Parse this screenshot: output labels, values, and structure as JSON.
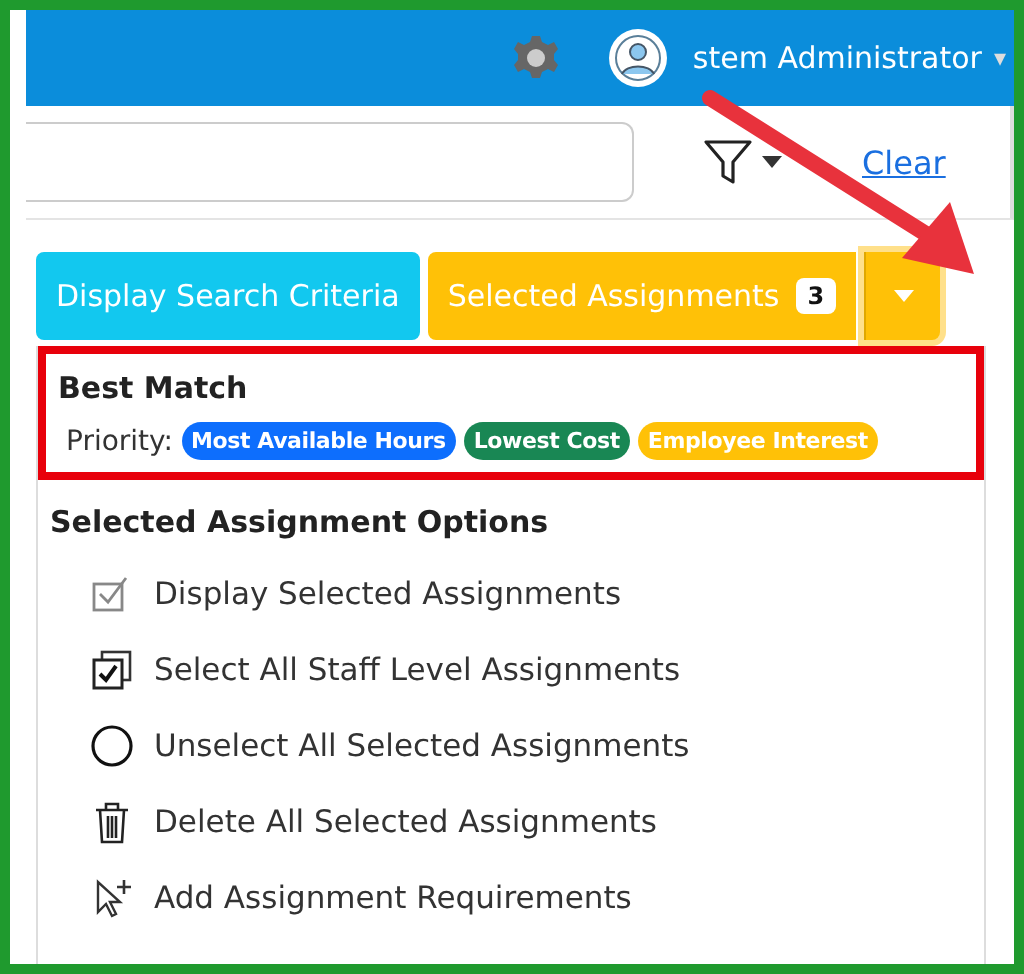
{
  "header": {
    "user_name": "stem Administrator",
    "user_caret": "▾"
  },
  "search": {
    "clear_link": "Clear"
  },
  "toolbar": {
    "buttons": [
      {
        "label": "Display Search Criteria",
        "kind": "info"
      },
      {
        "label": "Selected Assignments",
        "kind": "warning",
        "badge": "3"
      }
    ]
  },
  "menu": {
    "best_match": {
      "title": "Best Match",
      "priority_label": "Priority:",
      "highlighted": true,
      "tags": [
        {
          "label": "Most Available Hours",
          "color": "#0d6efd"
        },
        {
          "label": "Lowest Cost",
          "color": "#198754"
        },
        {
          "label": "Employee Interest",
          "color": "#ffc107"
        }
      ]
    },
    "options_title": "Selected Assignment Options",
    "options": [
      {
        "label": "Display Selected Assignments",
        "kind": "checkmark"
      },
      {
        "label": "Select All Staff Level Assignments",
        "kind": "checkboxes"
      },
      {
        "label": "Unselect All Selected Assignments",
        "kind": "circle"
      },
      {
        "label": "Delete All Selected Assignments",
        "kind": "trash"
      },
      {
        "label": "Add Assignment Requirements",
        "kind": "pointer-plus"
      }
    ]
  }
}
